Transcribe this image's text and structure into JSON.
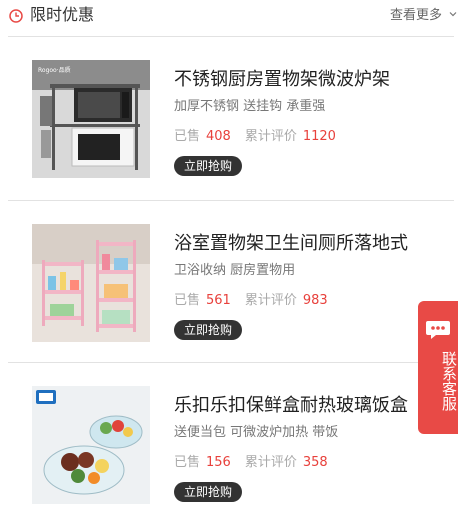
{
  "header": {
    "title": "限时优惠",
    "more_label": "查看更多",
    "accent_color": "#e84a46"
  },
  "products": [
    {
      "title": "不锈钢厨房置物架微波炉架",
      "subtitle": "加厚不锈钢 送挂钩 承重强",
      "sold_label": "已售",
      "sold_count": "408",
      "reviews_label": "累计评价",
      "reviews_count": "1120",
      "buy_label": "立即抢购",
      "image_icon": "microwave-rack-photo",
      "image_brand": "Rogoo·品质"
    },
    {
      "title": "浴室置物架卫生间厕所落地式",
      "subtitle": "卫浴收纳 厨房置物用",
      "sold_label": "已售",
      "sold_count": "561",
      "reviews_label": "累计评价",
      "reviews_count": "983",
      "buy_label": "立即抢购",
      "image_icon": "bathroom-shelf-photo"
    },
    {
      "title": "乐扣乐扣保鲜盒耐热玻璃饭盒",
      "subtitle": "送便当包 可微波炉加热 带饭",
      "sold_label": "已售",
      "sold_count": "156",
      "reviews_label": "累计评价",
      "reviews_count": "358",
      "buy_label": "立即抢购",
      "image_icon": "glass-lunchbox-photo"
    }
  ],
  "customer_service": {
    "label": "联系客服",
    "icon": "chat-bubble-icon",
    "color": "#e84a46"
  },
  "colors": {
    "price_red": "#e8413c",
    "button_dark": "#333333"
  }
}
